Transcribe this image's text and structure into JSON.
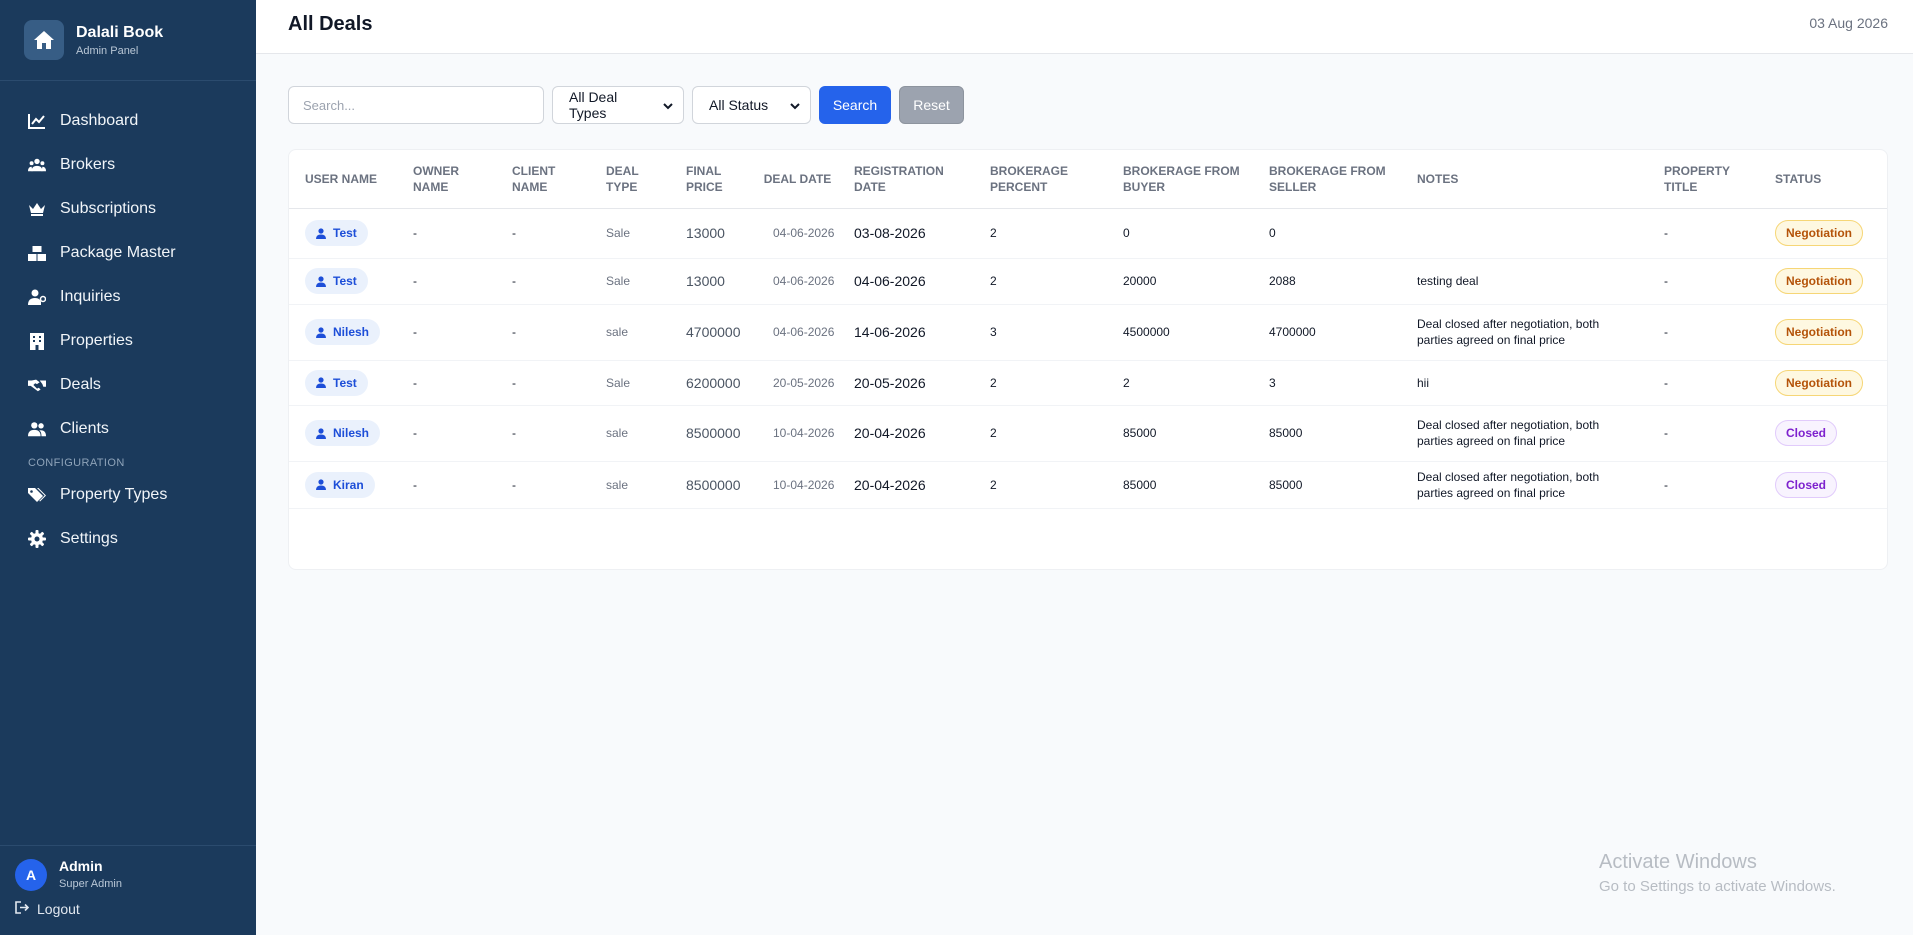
{
  "brand": {
    "name": "Dalali Book",
    "subtitle": "Admin Panel"
  },
  "nav": {
    "items": [
      {
        "label": "Dashboard",
        "icon": "chart-line-icon"
      },
      {
        "label": "Brokers",
        "icon": "users-icon"
      },
      {
        "label": "Subscriptions",
        "icon": "crown-icon"
      },
      {
        "label": "Package Master",
        "icon": "boxes-icon"
      },
      {
        "label": "Inquiries",
        "icon": "user-question-icon"
      },
      {
        "label": "Properties",
        "icon": "building-icon"
      },
      {
        "label": "Deals",
        "icon": "handshake-icon"
      },
      {
        "label": "Clients",
        "icon": "user-group-icon"
      }
    ],
    "section_label": "CONFIGURATION",
    "config_items": [
      {
        "label": "Property Types",
        "icon": "tags-icon"
      },
      {
        "label": "Settings",
        "icon": "gear-icon"
      }
    ]
  },
  "user": {
    "initial": "A",
    "name": "Admin",
    "role": "Super Admin",
    "logout_label": "Logout"
  },
  "header": {
    "title": "All Deals",
    "date": "03 Aug 2026"
  },
  "filters": {
    "search_placeholder": "Search...",
    "deal_type": "All Deal Types",
    "status": "All Status",
    "search_label": "Search",
    "reset_label": "Reset"
  },
  "table": {
    "columns": [
      "USER NAME",
      "OWNER NAME",
      "CLIENT NAME",
      "DEAL TYPE",
      "FINAL PRICE",
      "DEAL DATE",
      "REGISTRATION DATE",
      "BROKERAGE PERCENT",
      "BROKERAGE FROM BUYER",
      "BROKERAGE FROM SELLER",
      "NOTES",
      "PROPERTY TITLE",
      "STATUS"
    ],
    "rows": [
      {
        "user": "Test",
        "owner": "-",
        "client": "-",
        "deal_type": "Sale",
        "final_price": "13000",
        "deal_date": "04-06-2026",
        "registration_date": "03-08-2026",
        "brokerage_percent": "2",
        "from_buyer": "0",
        "from_seller": "0",
        "notes": "",
        "property_title": "-",
        "status": "Negotiation"
      },
      {
        "user": "Test",
        "owner": "-",
        "client": "-",
        "deal_type": "Sale",
        "final_price": "13000",
        "deal_date": "04-06-2026",
        "registration_date": "04-06-2026",
        "brokerage_percent": "2",
        "from_buyer": "20000",
        "from_seller": "2088",
        "notes": "testing deal",
        "property_title": "-",
        "status": "Negotiation"
      },
      {
        "user": "Nilesh",
        "owner": "-",
        "client": "-",
        "deal_type": "sale",
        "final_price": "4700000",
        "deal_date": "04-06-2026",
        "registration_date": "14-06-2026",
        "brokerage_percent": "3",
        "from_buyer": "4500000",
        "from_seller": "4700000",
        "notes": "Deal closed after negotiation, both parties agreed on final price",
        "property_title": "-",
        "status": "Negotiation"
      },
      {
        "user": "Test",
        "owner": "-",
        "client": "-",
        "deal_type": "Sale",
        "final_price": "6200000",
        "deal_date": "20-05-2026",
        "registration_date": "20-05-2026",
        "brokerage_percent": "2",
        "from_buyer": "2",
        "from_seller": "3",
        "notes": "hii",
        "property_title": "-",
        "status": "Negotiation"
      },
      {
        "user": "Nilesh",
        "owner": "-",
        "client": "-",
        "deal_type": "sale",
        "final_price": "8500000",
        "deal_date": "10-04-2026",
        "registration_date": "20-04-2026",
        "brokerage_percent": "2",
        "from_buyer": "85000",
        "from_seller": "85000",
        "notes": "Deal closed after negotiation, both parties agreed on final price",
        "property_title": "-",
        "status": "Closed"
      },
      {
        "user": "Kiran",
        "owner": "-",
        "client": "-",
        "deal_type": "sale",
        "final_price": "8500000",
        "deal_date": "10-04-2026",
        "registration_date": "20-04-2026",
        "brokerage_percent": "2",
        "from_buyer": "85000",
        "from_seller": "85000",
        "notes": "Deal closed after negotiation, both parties agreed on final price",
        "property_title": "-",
        "status": "Closed"
      }
    ]
  },
  "watermark": {
    "line1": "Activate Windows",
    "line2": "Go to Settings to activate Windows."
  },
  "colors": {
    "sidebar": "#1b3a5c",
    "primary": "#2563eb",
    "negotiation": "#b45309",
    "closed": "#7e22ce"
  }
}
